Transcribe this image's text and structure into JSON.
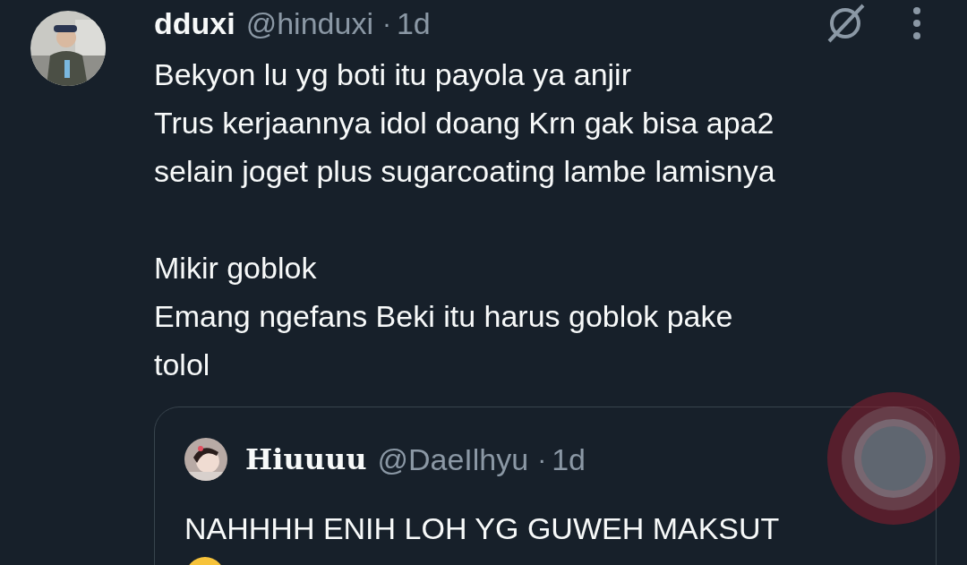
{
  "tweet": {
    "name": "dduxi",
    "handle": "@hinduxi",
    "dot": "·",
    "time": "1d",
    "paragraphs": [
      [
        "Bekyon lu yg boti itu payola ya anjir",
        "Trus kerjaannya idol doang Krn gak bisa apa2",
        "selain joget plus sugarcoating lambe lamisnya"
      ],
      [
        "Mikir goblok",
        "Emang ngefans Beki itu harus goblok pake",
        "tolol"
      ]
    ],
    "quote": {
      "name": "Hiuuuu",
      "handle": "@DaeIlhyu",
      "dot": "·",
      "time": "1d",
      "text": "NAHHHH ENIH LOH YG GUWEH MAKSUT"
    }
  }
}
